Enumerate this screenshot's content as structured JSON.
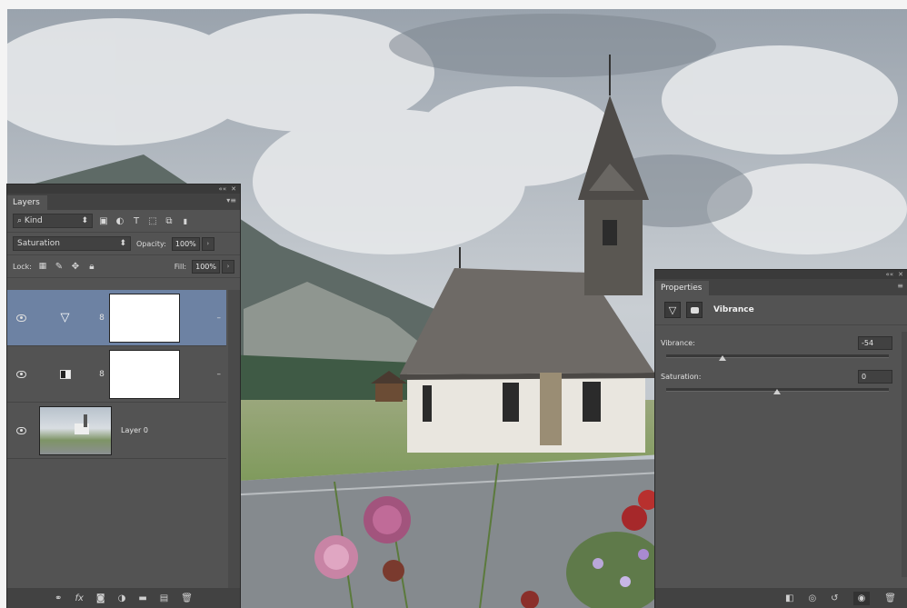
{
  "layers_panel": {
    "tab_label": "Layers",
    "filter_kind": "Kind",
    "blend_mode": "Saturation",
    "opacity_label": "Opacity:",
    "opacity_value": "100%",
    "lock_label": "Lock:",
    "fill_label": "Fill:",
    "fill_value": "100%",
    "layers": [
      {
        "type": "vibrance-adjustment",
        "selected": true
      },
      {
        "type": "levels-adjustment",
        "selected": false
      },
      {
        "name": "Layer 0",
        "type": "image",
        "selected": false
      }
    ],
    "bottom_icons": [
      "link-icon",
      "fx-icon",
      "mask-icon",
      "adjustment-icon",
      "folder-icon",
      "new-layer-icon",
      "trash-icon"
    ]
  },
  "properties_panel": {
    "tab_label": "Properties",
    "title": "Vibrance",
    "vibrance_label": "Vibrance:",
    "vibrance_value": "-54",
    "saturation_label": "Saturation:",
    "saturation_value": "0",
    "bottom_icons": [
      "clip-icon",
      "view-previous-icon",
      "reset-icon",
      "visibility-icon",
      "trash-icon"
    ]
  },
  "colors": {
    "panel_bg": "#535353",
    "panel_dark": "#424242",
    "selection": "#6d82a3"
  }
}
